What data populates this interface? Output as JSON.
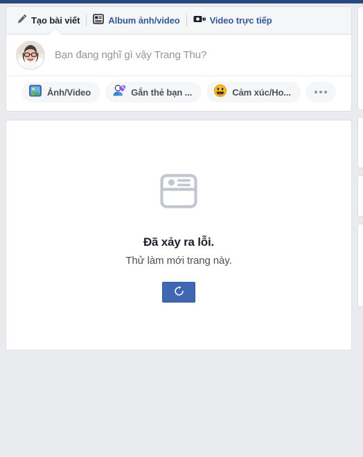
{
  "theme": {
    "page_bg": "#e9ebee",
    "card_bg": "#ffffff",
    "border": "#dddfe2",
    "link_blue": "#365899",
    "accent_blue": "#4267b2",
    "text_dark": "#1d2129",
    "text_muted": "#90949c",
    "chrome_navy": "#29487d"
  },
  "composer": {
    "tabs": [
      {
        "label": "Tạo bài viết",
        "icon": "pencil-icon",
        "active": true
      },
      {
        "label": "Album ảnh/video",
        "icon": "photo-album-icon",
        "active": false
      },
      {
        "label": "Video trực tiếp",
        "icon": "live-video-icon",
        "active": false
      }
    ],
    "avatar_alt": "Trang Thu",
    "placeholder": "Bạn đang nghĩ gì vậy Trang Thu?",
    "actions": [
      {
        "label": "Ảnh/Video",
        "icon": "photo-video-icon"
      },
      {
        "label": "Gắn thẻ bạn ...",
        "icon": "tag-friends-icon"
      },
      {
        "label": "Cảm xúc/Ho...",
        "icon": "feeling-activity-icon"
      }
    ],
    "more_label": "..."
  },
  "error": {
    "icon": "broken-post-card-icon",
    "title": "Đã xảy ra lỗi.",
    "subtitle": "Thử làm mới trang này.",
    "refresh_icon": "refresh-icon"
  }
}
